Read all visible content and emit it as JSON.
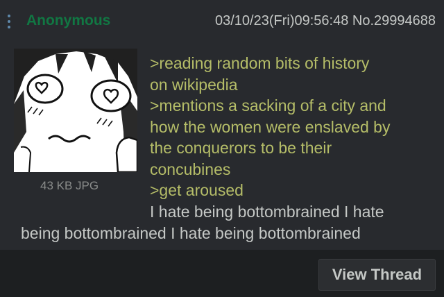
{
  "post": {
    "name": "Anonymous",
    "meta": "03/10/23(Fri)09:56:48 No.29994688",
    "file_info": "43 KB JPG",
    "greentext": [
      ">reading random bits of history",
      "on wikipedia",
      ">mentions a sacking of a city and",
      "how the women were enslaved by",
      "the conquerors to be their",
      "concubines",
      ">get aroused"
    ],
    "text_line1": "I hate being bottombrained I hate",
    "text_line2": "being bottombrained I hate being bottombrained"
  },
  "footer": {
    "view_thread_label": "View Thread"
  },
  "colors": {
    "post_bg": "#282a2e",
    "page_bg": "#1d1f21",
    "name": "#117743",
    "greentext": "#b5bd68",
    "text": "#c5c8c6",
    "menu_dots": "#5f89ac"
  },
  "icons": {
    "menu": "vertical-ellipsis-icon",
    "thumbnail": "anime-girl-heart-eyes-image"
  }
}
